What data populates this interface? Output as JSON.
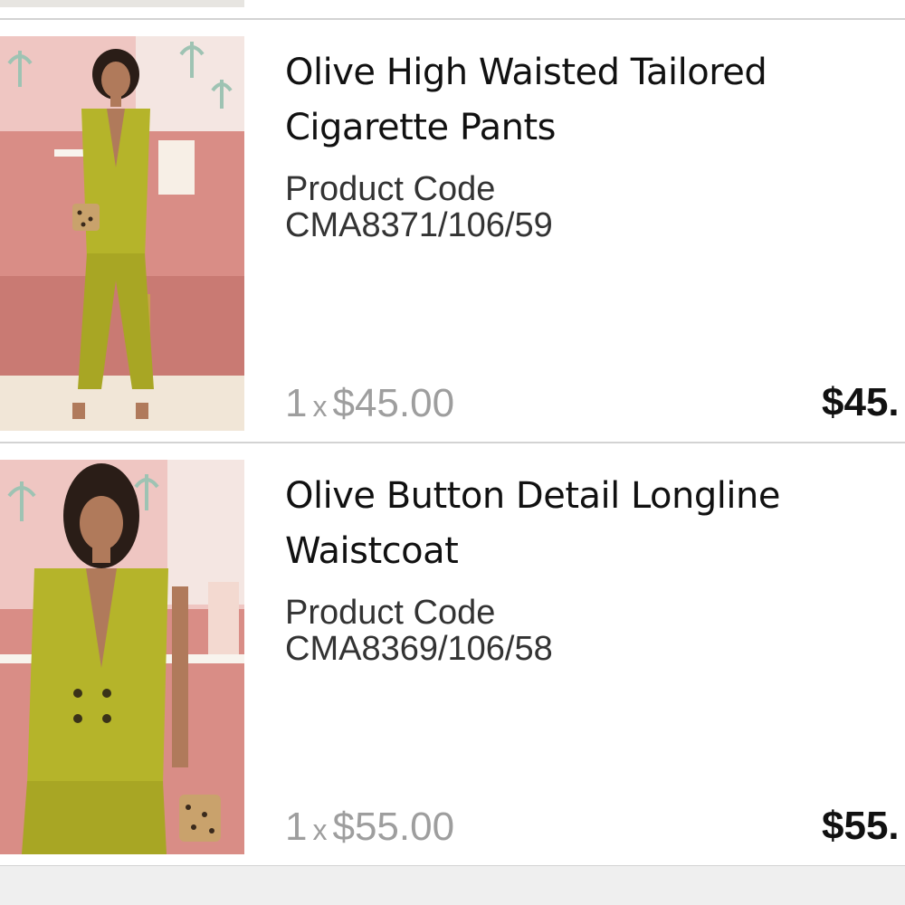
{
  "cart": {
    "items": [
      {
        "title": "Olive High Waisted Tailored Cigarette Pants",
        "code_label": "Product Code",
        "code": "CMA8371/106/59",
        "qty": "1",
        "qty_sep": "x",
        "unit_price": "$45.00",
        "line_total": "$45.",
        "image_icon": "product-photo-pants"
      },
      {
        "title": "Olive Button Detail Longline Waistcoat",
        "code_label": "Product Code",
        "code": "CMA8369/106/58",
        "qty": "1",
        "qty_sep": "x",
        "unit_price": "$55.00",
        "line_total": "$55.",
        "image_icon": "product-photo-waistcoat"
      }
    ]
  },
  "colors": {
    "olive": "#b5b42a",
    "divider": "#d3d3d3",
    "muted_price": "#9e9e9e",
    "text": "#111111"
  }
}
